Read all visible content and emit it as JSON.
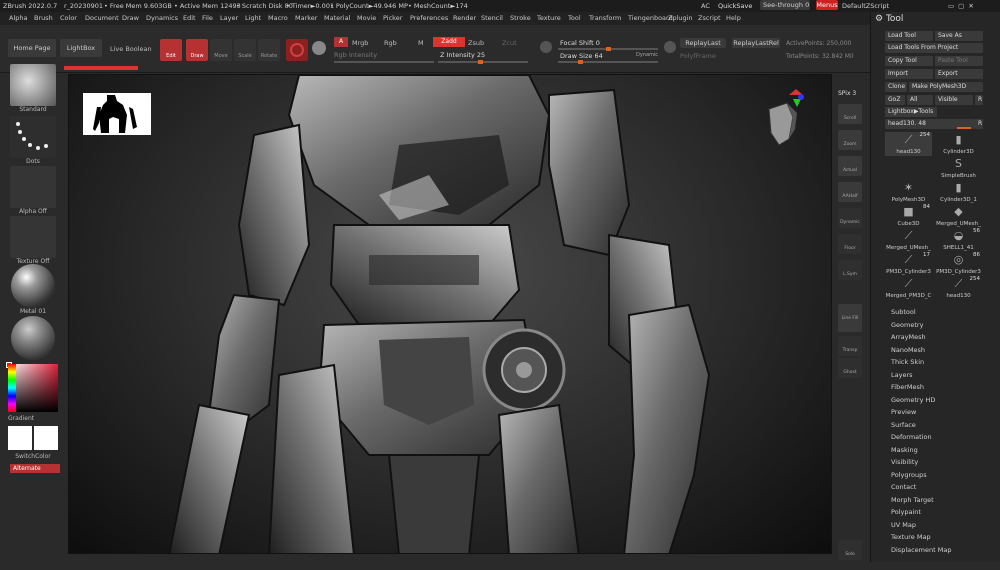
{
  "titlebar": {
    "app": "ZBrush 2022.0.7",
    "project": "r_20230901",
    "free_mem": "• Free Mem 9.603GB",
    "active_mem": "• Active Mem 12493",
    "scratch": "• Scratch Disk 80",
    "timer": "• Timer►0.001",
    "polycount": "• PolyCount►49.946 MP",
    "meshcount": "• MeshCount►174",
    "ac": "AC",
    "quicksave": "QuickSave",
    "seethrough": "See-through  0",
    "menus": "Menus",
    "defaultzscript": "DefaultZScript"
  },
  "menubar": [
    "Alpha",
    "Brush",
    "Color",
    "Document",
    "Draw",
    "Dynamics",
    "Edit",
    "File",
    "Layer",
    "Light",
    "Macro",
    "Marker",
    "Material",
    "Movie",
    "Picker",
    "Preferences",
    "Render",
    "Stencil",
    "Stroke",
    "Texture",
    "Tool",
    "Transform",
    "Zplugin",
    "Zscript",
    "Help"
  ],
  "shelf": {
    "home_page": "Home Page",
    "lightbox": "LightBox",
    "live_boolean": "Live Boolean",
    "edit": "Edit",
    "draw": "Draw",
    "move": "Move",
    "scale": "Scale",
    "rotate": "Rotate",
    "a": "A",
    "mrgb": "Mrgb",
    "rgb": "Rgb",
    "m": "M",
    "zadd": "Zadd",
    "zsub": "Zsub",
    "zcut": "Zcut",
    "rgb_intensity": "Rgb Intensity",
    "z_intensity": "Z Intensity 25",
    "focal_shift": "Focal Shift 0",
    "draw_size": "Draw Size 64",
    "dynamic": "Dynamic",
    "replay_last": "ReplayLast",
    "replay_last_rel": "ReplayLastRel",
    "active_points": "ActivePoints: 250,000",
    "total_points": "TotalPoints: 32.842 Mil",
    "polyf": "PolyfFrame"
  },
  "left_tray": {
    "brush": "Standard",
    "stroke": "Dots",
    "alpha": "Alpha Off",
    "texture": "Texture Off",
    "material": "Metal 01",
    "gradient": "Gradient",
    "switch_color": "SwitchColor",
    "alternate": "Alternate"
  },
  "right_strip": [
    "SPix 3",
    "Scroll",
    "Zoom",
    "Actual",
    "AAHalf",
    "Dynamic Persp",
    "Floor",
    "L.Sym",
    "Line Fill PolyF",
    "Transp",
    "Ghost",
    "Solo"
  ],
  "tool_panel": {
    "title": "Tool",
    "load_tool": "Load Tool",
    "save_as": "Save As",
    "load_from_project": "Load Tools From Project",
    "copy_tool": "Copy Tool",
    "paste_tool": "Paste Tool",
    "import": "Import",
    "export": "Export",
    "clone": "Clone",
    "make_polymesh": "Make PolyMesh3D",
    "goz": "GoZ",
    "all": "All",
    "visible": "Visible",
    "r": "R",
    "lightbox_tools": "Lightbox▶Tools",
    "current": "head130. 48",
    "tools": [
      {
        "name": "head130",
        "count": "254",
        "icon": "⟋"
      },
      {
        "name": "Cylinder3D",
        "count": "",
        "icon": "▮"
      },
      {
        "name": "",
        "count": "",
        "icon": ""
      },
      {
        "name": "SimpleBrush",
        "count": "",
        "icon": "S"
      },
      {
        "name": "PolyMesh3D",
        "count": "",
        "icon": "✶"
      },
      {
        "name": "Cylinder3D_1",
        "count": "",
        "icon": "▮"
      },
      {
        "name": "Cube3D",
        "count": "84",
        "icon": "■"
      },
      {
        "name": "Merged_UMesh_",
        "count": "",
        "icon": "◆"
      },
      {
        "name": "Merged_UMesh_",
        "count": "",
        "icon": "⟋"
      },
      {
        "name": "SHELL1_41",
        "count": "56",
        "icon": "◒"
      },
      {
        "name": "PM3D_Cylinder3",
        "count": "17",
        "icon": "⟋"
      },
      {
        "name": "PM3D_Cylinder3",
        "count": "86",
        "icon": "◎"
      },
      {
        "name": "Merged_PM3D_C",
        "count": "",
        "icon": "⟋"
      },
      {
        "name": "head130",
        "count": "254",
        "icon": "⟋"
      }
    ],
    "subpalettes": [
      "Subtool",
      "Geometry",
      "ArrayMesh",
      "NanoMesh",
      "Thick Skin",
      "Layers",
      "FiberMesh",
      "Geometry HD",
      "Preview",
      "Surface",
      "Deformation",
      "Masking",
      "Visibility",
      "Polygroups",
      "Contact",
      "Morph Target",
      "Polypaint",
      "UV Map",
      "Texture Map",
      "Displacement Map"
    ]
  },
  "colors": {
    "accent_red": "#b63131",
    "orange": "#e06020",
    "panel_bg": "#262626"
  }
}
